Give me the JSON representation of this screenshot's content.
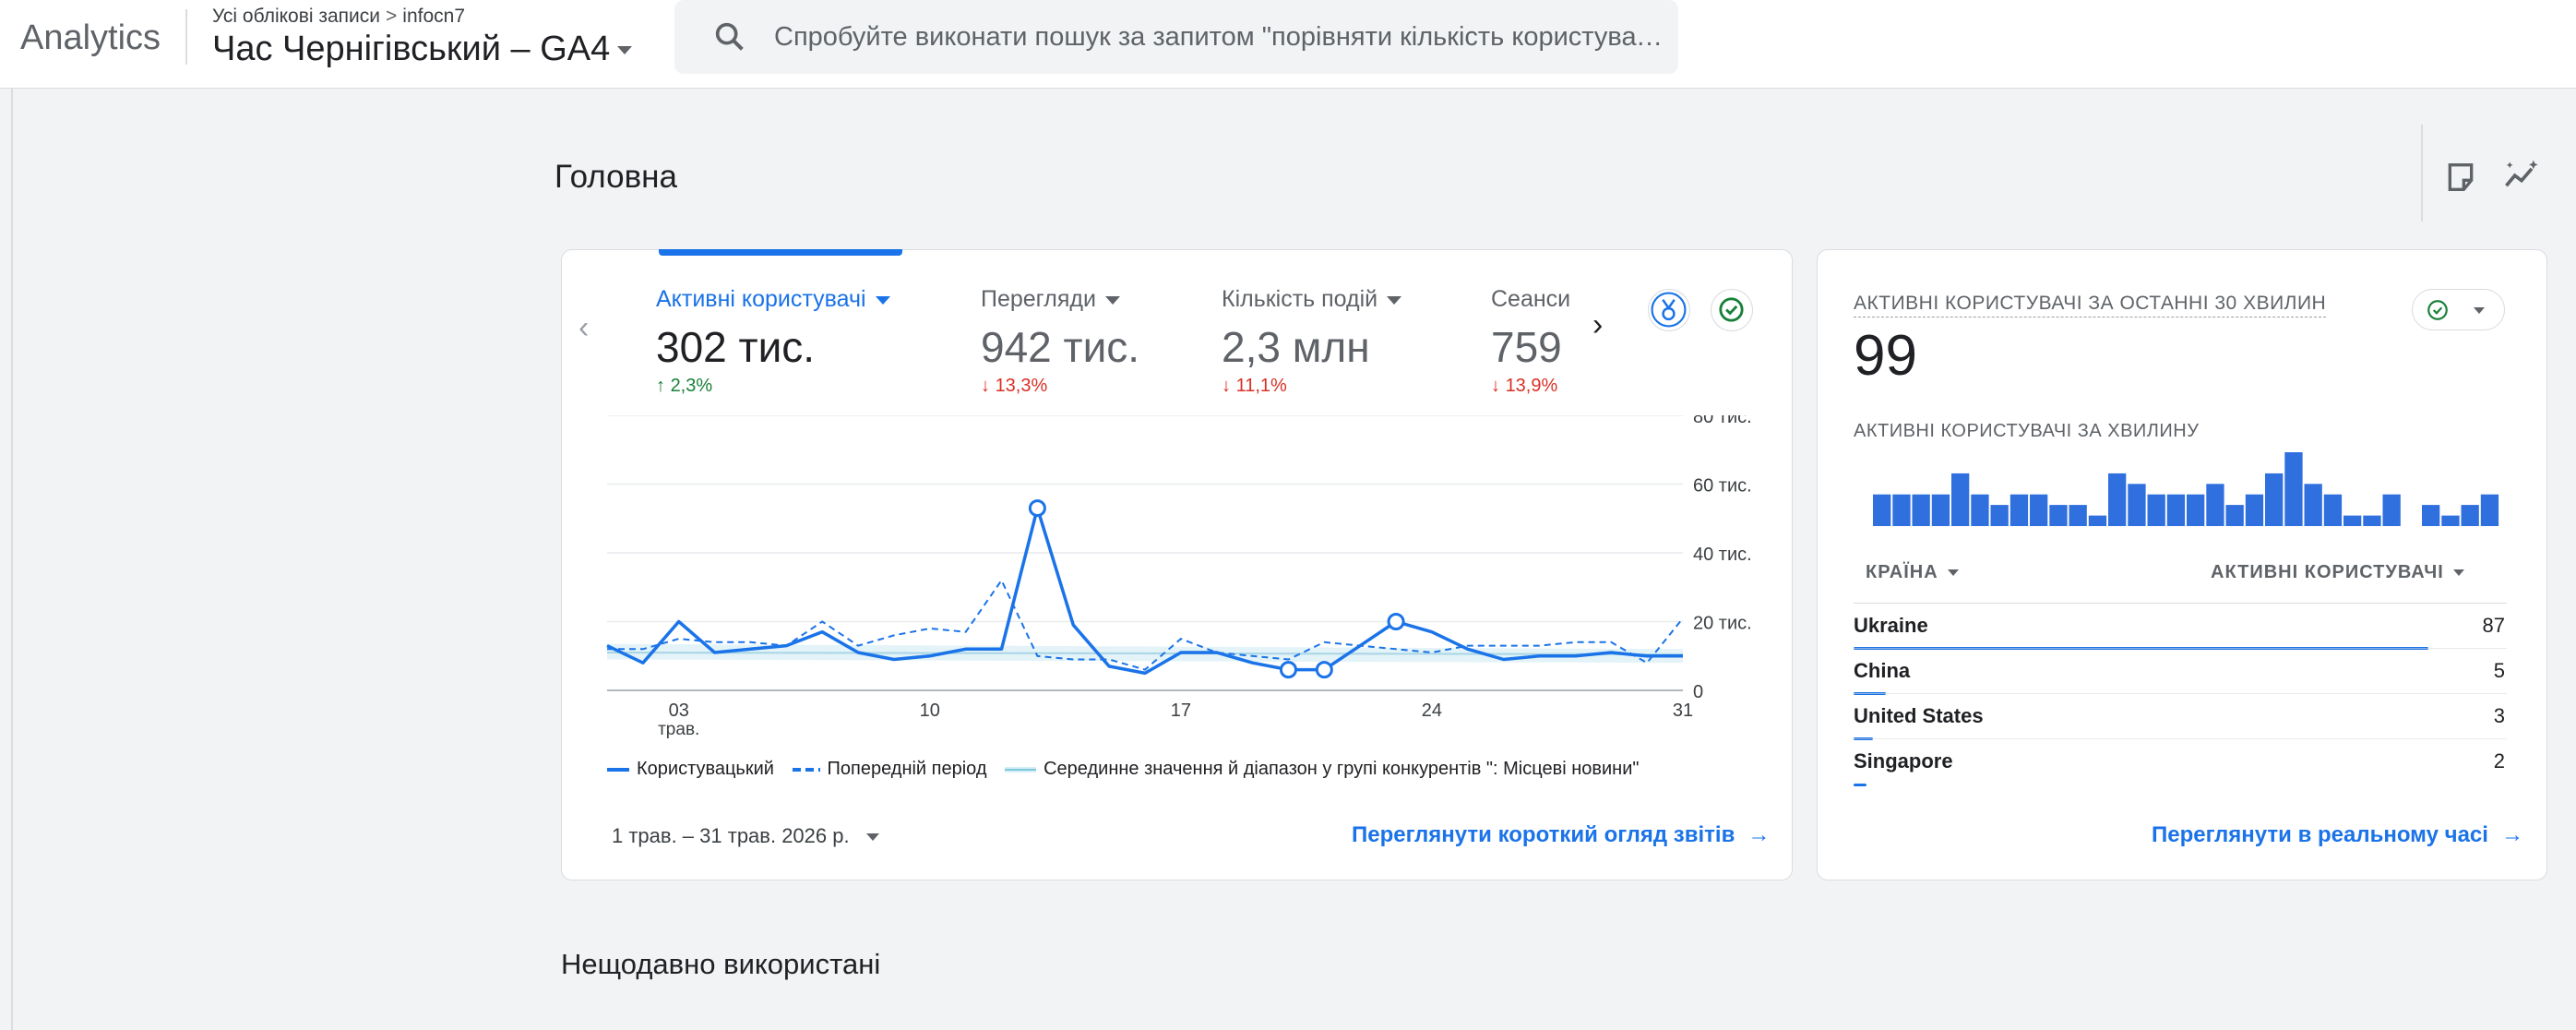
{
  "header": {
    "app_name": "Analytics",
    "breadcrumb_root": "Усі облікові записи",
    "breadcrumb_account": "infocn7",
    "property_name": "Час Чернігівський – GA4",
    "search_placeholder": "Спробуйте виконати пошук за запитом \"порівняти кількість користувачів"
  },
  "page": {
    "title": "Головна",
    "recently_used_title": "Нещодавно використані"
  },
  "toolbar_icons": [
    "notes-icon",
    "insights-icon"
  ],
  "overview_card": {
    "kpis": [
      {
        "label": "Активні користувачі",
        "value": "302 тис.",
        "change": "2,3%",
        "direction": "up"
      },
      {
        "label": "Перегляди",
        "value": "942 тис.",
        "change": "13,3%",
        "direction": "down"
      },
      {
        "label": "Кількість подій",
        "value": "2,3 млн",
        "change": "11,1%",
        "direction": "down"
      },
      {
        "label": "Сеанси",
        "value": "759",
        "change": "13,9%",
        "direction": "down"
      }
    ],
    "legend": {
      "current": "Користувацький",
      "previous": "Попередній період",
      "benchmark": "Серединне значення й діапазон у групі конкурентів \": Місцеві новини\""
    },
    "date_range": "1 трав. – 31 трав. 2026 р.",
    "view_link": "Переглянути короткий огляд звітів",
    "colors": {
      "accent": "#1a73e8",
      "up": "#188038",
      "down": "#d93025",
      "benchmark": "#a8d5e5"
    }
  },
  "chart_data": {
    "type": "line",
    "x_ticks": [
      "03",
      "10",
      "17",
      "24",
      "31"
    ],
    "x_tick_sub": "трав.",
    "y_ticks": [
      "80 тис.",
      "60 тис.",
      "40 тис.",
      "20 тис.",
      "0"
    ],
    "ylim": [
      0,
      80000
    ],
    "grid": true,
    "x": [
      1,
      2,
      3,
      4,
      5,
      6,
      7,
      8,
      9,
      10,
      11,
      12,
      13,
      14,
      15,
      16,
      17,
      18,
      19,
      20,
      21,
      22,
      23,
      24,
      25,
      26,
      27,
      28,
      29,
      30,
      31
    ],
    "series": [
      {
        "name": "Користувацький",
        "style": "solid",
        "values": [
          13000,
          8000,
          20000,
          11000,
          12000,
          13000,
          17000,
          11000,
          9000,
          10000,
          12000,
          12000,
          53000,
          19000,
          7000,
          5000,
          11000,
          11000,
          8000,
          6000,
          6000,
          13000,
          20000,
          17000,
          12000,
          9000,
          10000,
          10000,
          11000,
          10000,
          10000
        ],
        "highlighted_x": [
          13,
          20,
          21,
          23
        ]
      },
      {
        "name": "Попередній період",
        "style": "dashed",
        "values": [
          12000,
          12000,
          15000,
          14000,
          14000,
          13000,
          20000,
          13000,
          16000,
          18000,
          17000,
          32000,
          10000,
          9000,
          9000,
          6000,
          15000,
          11000,
          10000,
          9000,
          14000,
          13000,
          12000,
          11000,
          13000,
          13000,
          13000,
          14000,
          14000,
          8000,
          21000
        ]
      },
      {
        "name": "Серединне значення й діапазон у групі конкурентів \": Місцеві новини\"",
        "style": "band",
        "values": []
      }
    ]
  },
  "realtime_card": {
    "heading": "АКТИВНІ КОРИСТУВАЧІ ЗА ОСТАННІ 30 ХВИЛИН",
    "value": "99",
    "per_minute_label": "АКТИВНІ КОРИСТУВАЧІ ЗА ХВИЛИНУ",
    "per_minute_values": [
      3,
      3,
      3,
      3,
      5,
      3,
      2,
      3,
      3,
      2,
      2,
      1,
      5,
      4,
      3,
      3,
      3,
      4,
      2,
      3,
      5,
      7,
      4,
      3,
      1,
      1,
      3,
      0,
      2,
      1,
      2,
      3
    ],
    "column_country": "КРАЇНА",
    "column_users": "АКТИВНІ КОРИСТУВАЧІ",
    "rows": [
      {
        "country": "Ukraine",
        "value": "87",
        "share": 0.88
      },
      {
        "country": "China",
        "value": "5",
        "share": 0.05
      },
      {
        "country": "United States",
        "value": "3",
        "share": 0.03
      },
      {
        "country": "Singapore",
        "value": "2",
        "share": 0.02
      }
    ],
    "view_link": "Переглянути в реальному часі"
  }
}
